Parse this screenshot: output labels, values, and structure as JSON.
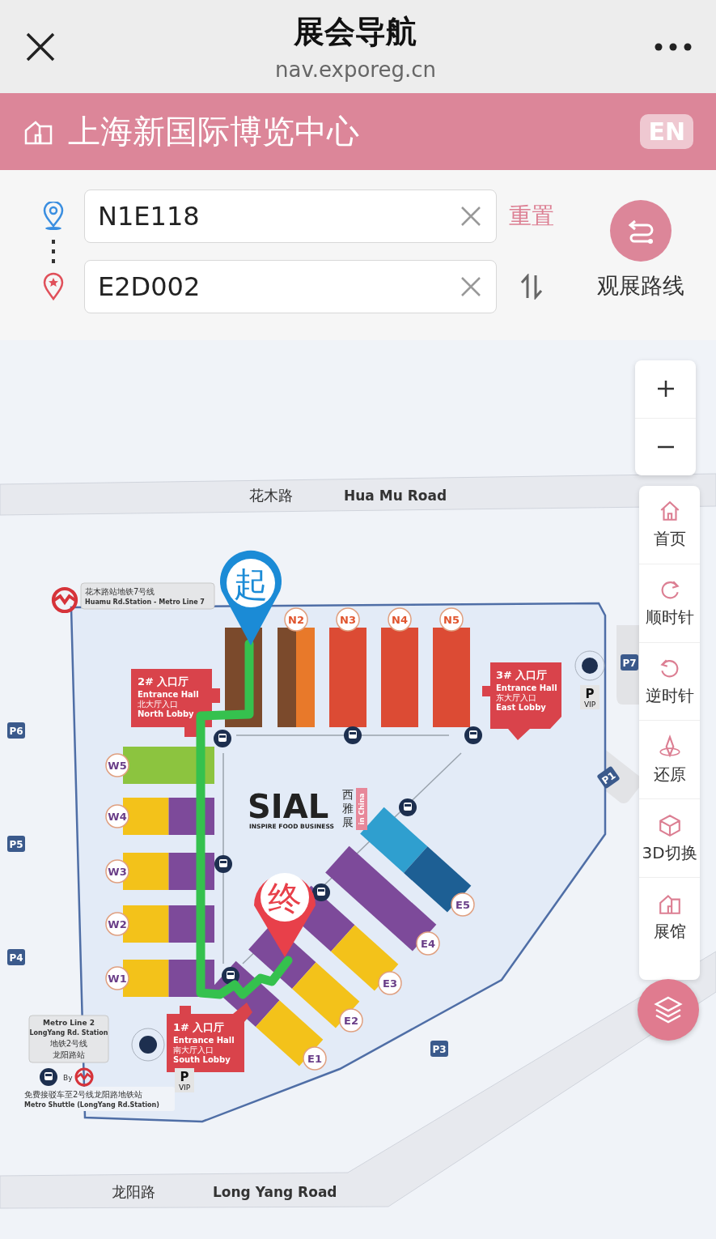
{
  "browser": {
    "title": "展会导航",
    "url": "nav.exporeg.cn"
  },
  "venue": {
    "name": "上海新国际博览中心",
    "language_button": "EN"
  },
  "route": {
    "start": {
      "value": "N1E118"
    },
    "end": {
      "value": "E2D002"
    },
    "reset": "重置",
    "tour_button": "观展路线"
  },
  "map": {
    "roads": [
      {
        "name_zh": "花木路",
        "name_en": "Hua Mu Road"
      },
      {
        "name_zh": "龙阳路",
        "name_en": "Long Yang Road"
      }
    ],
    "halls": [
      {
        "kind": "north",
        "sections": [
          {
            "color": "#7b4a2c"
          }
        ]
      },
      {
        "kind": "north",
        "code": "N2",
        "sections": [
          {
            "color": "#7b4a2c"
          },
          {
            "color": "#e8792a"
          }
        ]
      },
      {
        "kind": "north",
        "code": "N3",
        "sections": [
          {
            "color": "#dc4b34"
          }
        ]
      },
      {
        "kind": "north",
        "code": "N4",
        "sections": [
          {
            "color": "#dc4b34"
          }
        ]
      },
      {
        "kind": "north",
        "code": "N5",
        "sections": [
          {
            "color": "#dc4b34"
          }
        ]
      },
      {
        "kind": "west",
        "code": "W5",
        "sections": [
          {
            "color": "#8cc43f"
          }
        ]
      },
      {
        "kind": "west",
        "code": "W4",
        "sections": [
          {
            "color": "#f3c21a"
          },
          {
            "color": "#7d4a9a"
          }
        ]
      },
      {
        "kind": "west",
        "code": "W3",
        "sections": [
          {
            "color": "#f3c21a"
          },
          {
            "color": "#7d4a9a"
          }
        ]
      },
      {
        "kind": "west",
        "code": "W2",
        "sections": [
          {
            "color": "#f3c21a"
          },
          {
            "color": "#7d4a9a"
          }
        ]
      },
      {
        "kind": "west",
        "code": "W1",
        "sections": [
          {
            "color": "#f3c21a"
          },
          {
            "color": "#7d4a9a"
          }
        ]
      },
      {
        "kind": "east",
        "code": "E5",
        "sections": [
          {
            "color": "#2f9fcf"
          },
          {
            "color": "#1d5f94"
          }
        ]
      },
      {
        "kind": "east",
        "code": "E4",
        "sections": [
          {
            "color": "#7d4a9a"
          }
        ]
      },
      {
        "kind": "east",
        "code": "E3",
        "sections": [
          {
            "color": "#7d4a9a"
          },
          {
            "color": "#f3c21a"
          }
        ]
      },
      {
        "kind": "east",
        "code": "E2",
        "sections": [
          {
            "color": "#7d4a9a"
          },
          {
            "color": "#f3c21a"
          }
        ]
      },
      {
        "kind": "east",
        "code": "E1",
        "sections": [
          {
            "color": "#7d4a9a"
          },
          {
            "color": "#f3c21a"
          }
        ]
      }
    ],
    "lobbies": [
      {
        "lines": [
          "2# 入口厅",
          "Entrance Hall",
          "北大厅入口",
          "North Lobby"
        ]
      },
      {
        "lines": [
          "3# 入口厅",
          "Entrance Hall",
          "东大厅入口",
          "East Lobby"
        ]
      },
      {
        "lines": [
          "1# 入口厅",
          "Entrance Hall",
          "南大厅入口",
          "South Lobby"
        ]
      }
    ],
    "metro_labels": [
      {
        "lines": [
          "花木路站地铁7号线",
          "Huamu Rd.Station - Metro Line 7"
        ]
      },
      {
        "lines": [
          "Metro Line 2",
          "LongYang Rd. Station",
          "地铁2号线",
          "龙阳路站"
        ]
      }
    ],
    "shuttle": {
      "connector": "By",
      "lines": [
        "免费接驳车至2号线龙阳路地铁站",
        "Metro Shuttle (LongYang Rd.Station)"
      ]
    },
    "logo": {
      "brand": "SIAL",
      "tagline": "INSPIRE FOOD BUSINESS",
      "chinese": "西雅展",
      "region": "in China"
    },
    "parking": [
      {
        "label": "P6"
      },
      {
        "label": "P5"
      },
      {
        "label": "P4"
      },
      {
        "label": "P7"
      },
      {
        "label": "P3"
      },
      {
        "label": "P1"
      }
    ],
    "vip_parking": [
      {
        "label": "P",
        "sub": "VIP"
      },
      {
        "label": "P",
        "sub": "VIP"
      }
    ],
    "start_pin": "起",
    "end_pin": "终"
  },
  "tools": [
    {
      "kind": "home",
      "label": "首页"
    },
    {
      "kind": "clockwise",
      "label": "顺时针"
    },
    {
      "kind": "counterclockwise",
      "label": "逆时针"
    },
    {
      "kind": "reset",
      "label": "还原"
    },
    {
      "kind": "cube",
      "label": "3D切换"
    },
    {
      "kind": "hall",
      "label": "展馆"
    }
  ]
}
